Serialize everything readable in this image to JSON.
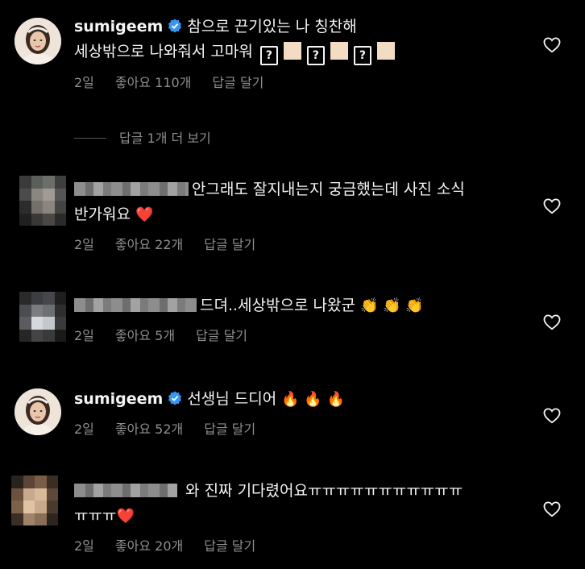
{
  "comments": [
    {
      "username": "sumigeem",
      "text_line1": "참으로 끈기있는 나 칭찬해",
      "text_line2": "세상밖으로 나와줘서 고마워",
      "qmark": "?",
      "time": "2일",
      "likes": "좋아요 110개",
      "reply": "답글 달기"
    },
    {
      "text_line1": "안그래도 잘지내는지 궁금했는데 사진 소식",
      "text_line2": "반가워요",
      "emoji": "❤️",
      "time": "2일",
      "likes": "좋아요 22개",
      "reply": "답글 달기"
    },
    {
      "text_line1": "드뎌..세상밖으로 나왔군",
      "emoji": "👏 👏 👏",
      "time": "2일",
      "likes": "좋아요 5개",
      "reply": "답글 달기"
    },
    {
      "username": "sumigeem",
      "text_line1": "선생님 드디어",
      "emoji": "🔥 🔥 🔥",
      "time": "2일",
      "likes": "좋아요 52개",
      "reply": "답글 달기"
    },
    {
      "text_line1": "와 진짜 기다렸어요ㅠㅠㅠㅠㅠㅠㅠㅠㅠㅠㅠ",
      "text_line2": "ㅠㅠㅠ",
      "emoji": "❤️",
      "time": "2일",
      "likes": "좋아요 20개",
      "reply": "답글 달기"
    }
  ],
  "view_replies": "답글 1개 더 보기",
  "icons": {
    "like": "heart-outline-icon",
    "verified": "verified-badge-icon"
  },
  "colors": {
    "background": "#000000",
    "text": "#f5f5f5",
    "secondary": "#8e8e8e",
    "verified": "#3797f0"
  }
}
